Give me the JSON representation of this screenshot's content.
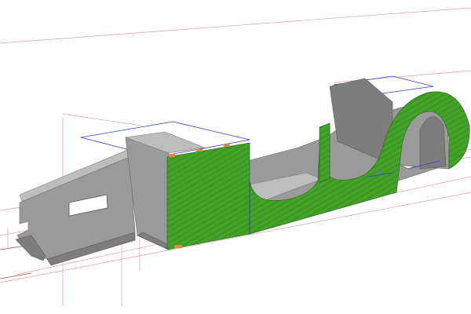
{
  "colors": {
    "background": "#ffffff",
    "panel_grey": "#9a9a9a",
    "panel_dark": "#7d7d7d",
    "panel_light": "#bdbdbd",
    "surface_green": "#3da028",
    "surface_hatch": "#c8a23a",
    "reference_red": "#d9a2a2",
    "reference_blue": "#3a3acc",
    "tab_orange": "#e08a3a"
  }
}
